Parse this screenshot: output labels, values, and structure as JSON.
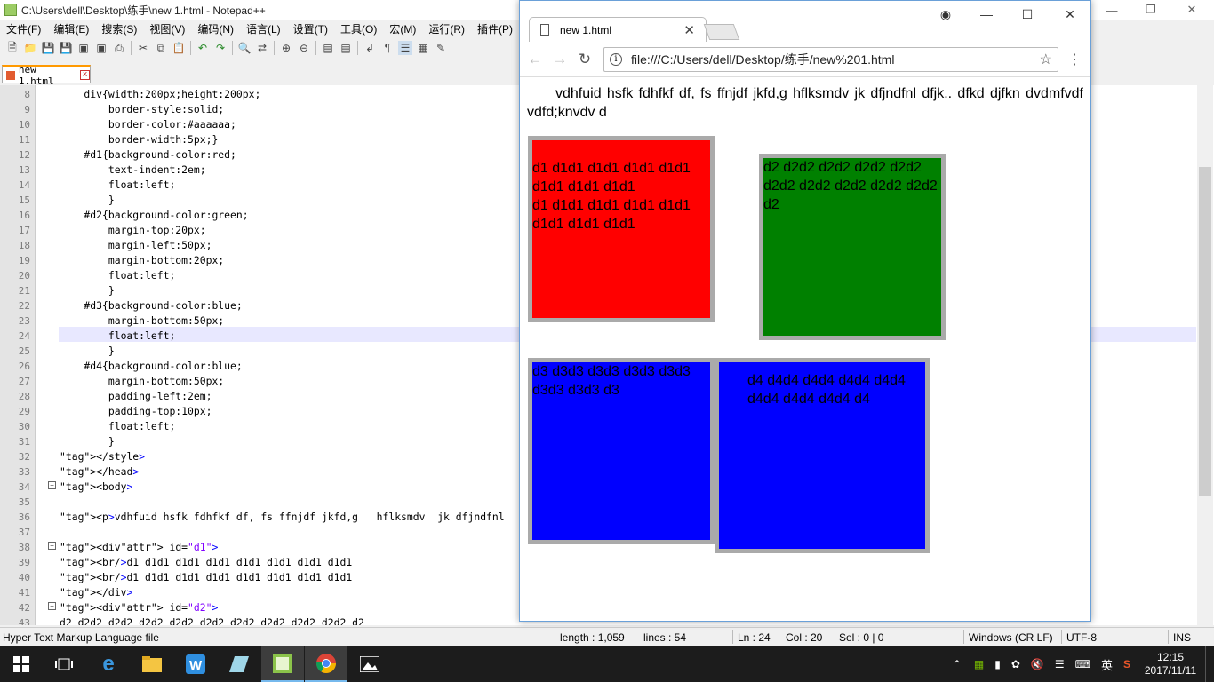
{
  "notepad": {
    "title": "C:\\Users\\dell\\Desktop\\练手\\new 1.html - Notepad++",
    "menu": [
      "文件(F)",
      "编辑(E)",
      "搜索(S)",
      "视图(V)",
      "编码(N)",
      "语言(L)",
      "设置(T)",
      "工具(O)",
      "宏(M)",
      "运行(R)",
      "插件(P)"
    ],
    "tab_label": "new 1.html",
    "tab_close": "x",
    "lines": [
      {
        "n": "8",
        "t": "    div{width:200px;height:200px;"
      },
      {
        "n": "9",
        "t": "        border-style:solid;"
      },
      {
        "n": "10",
        "t": "        border-color:#aaaaaa;"
      },
      {
        "n": "11",
        "t": "        border-width:5px;}"
      },
      {
        "n": "12",
        "t": "    #d1{background-color:red;"
      },
      {
        "n": "13",
        "t": "        text-indent:2em;"
      },
      {
        "n": "14",
        "t": "        float:left;"
      },
      {
        "n": "15",
        "t": "        }"
      },
      {
        "n": "16",
        "t": "    #d2{background-color:green;"
      },
      {
        "n": "17",
        "t": "        margin-top:20px;"
      },
      {
        "n": "18",
        "t": "        margin-left:50px;"
      },
      {
        "n": "19",
        "t": "        margin-bottom:20px;"
      },
      {
        "n": "20",
        "t": "        float:left;"
      },
      {
        "n": "21",
        "t": "        }"
      },
      {
        "n": "22",
        "t": "    #d3{background-color:blue;"
      },
      {
        "n": "23",
        "t": "        margin-bottom:50px;"
      },
      {
        "n": "24",
        "t": "        float:left;"
      },
      {
        "n": "25",
        "t": "        }"
      },
      {
        "n": "26",
        "t": "    #d4{background-color:blue;"
      },
      {
        "n": "27",
        "t": "        margin-bottom:50px;"
      },
      {
        "n": "28",
        "t": "        padding-left:2em;"
      },
      {
        "n": "29",
        "t": "        padding-top:10px;"
      },
      {
        "n": "30",
        "t": "        float:left;"
      },
      {
        "n": "31",
        "t": "        }"
      },
      {
        "n": "32",
        "t": "</style>"
      },
      {
        "n": "33",
        "t": "</head>"
      },
      {
        "n": "34",
        "t": "<body>"
      },
      {
        "n": "35",
        "t": ""
      },
      {
        "n": "36",
        "t": "<p>vdhfuid hsfk fdhfkf df, fs ffnjdf jkfd,g   hflksmdv  jk dfjndfnl"
      },
      {
        "n": "37",
        "t": ""
      },
      {
        "n": "38",
        "t": "<div id=\"d1\">"
      },
      {
        "n": "39",
        "t": "<br/>d1 d1d1 d1d1 d1d1 d1d1 d1d1 d1d1 d1d1"
      },
      {
        "n": "40",
        "t": "<br/>d1 d1d1 d1d1 d1d1 d1d1 d1d1 d1d1 d1d1"
      },
      {
        "n": "41",
        "t": "</div>"
      },
      {
        "n": "42",
        "t": "<div id=\"d2\">"
      },
      {
        "n": "43",
        "t": "d2 d2d2 d2d2 d2d2 d2d2 d2d2 d2d2 d2d2 d2d2 d2d2 d2"
      }
    ],
    "status": {
      "file_type": "Hyper Text Markup Language file",
      "length": "length : 1,059",
      "lines": "lines : 54",
      "ln": "Ln : 24",
      "col": "Col : 20",
      "sel": "Sel : 0 | 0",
      "eol": "Windows (CR LF)",
      "encoding": "UTF-8",
      "mode": "INS"
    }
  },
  "browser": {
    "tab_title": "new 1.html",
    "url": "file:///C:/Users/dell/Desktop/练手/new%201.html",
    "paragraph": "vdhfuid hsfk fdhfkf df, fs ffnjdf jkfd,g hflksmdv jk dfjndfnl dfjk.. dfkd djfkn dvdmfvdf vdfd;knvdv d",
    "d1_line1": "d1 d1d1 d1d1 d1d1 d1d1 d1d1 d1d1 d1d1",
    "d1_line2": "d1 d1d1 d1d1 d1d1 d1d1 d1d1 d1d1 d1d1",
    "d2_text": "d2 d2d2 d2d2 d2d2 d2d2 d2d2 d2d2 d2d2 d2d2 d2d2 d2",
    "d3_text": "d3 d3d3 d3d3 d3d3 d3d3 d3d3 d3d3 d3",
    "d4_text": "d4 d4d4 d4d4 d4d4 d4d4 d4d4 d4d4 d4d4 d4",
    "colors": {
      "d1": "#ff0000",
      "d2": "#008000",
      "d3": "#0000ff",
      "d4": "#0000ff",
      "border": "#aaaaaa"
    }
  },
  "taskbar": {
    "ime": "英",
    "time": "12:15",
    "date": "2017/11/11"
  }
}
